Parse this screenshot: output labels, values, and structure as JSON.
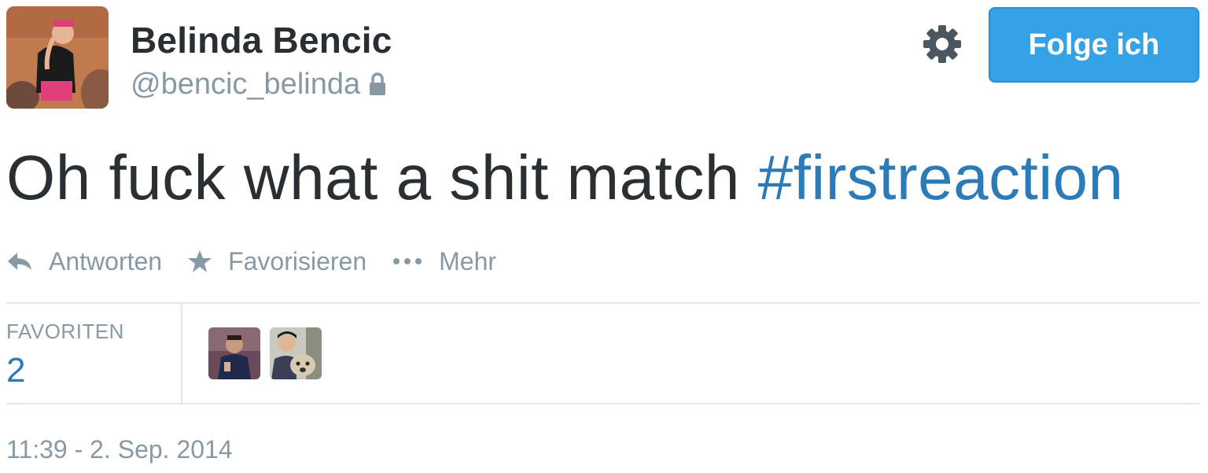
{
  "user": {
    "display_name": "Belinda Bencic",
    "handle": "@bencic_belinda",
    "protected_icon": "lock-icon"
  },
  "header": {
    "settings_icon": "gear-icon",
    "follow_label": "Folge ich"
  },
  "tweet": {
    "text": "Oh fuck what a shit match ",
    "hashtag": "#firstreaction"
  },
  "actions": [
    {
      "label": "Antworten",
      "icon": "reply-icon"
    },
    {
      "label": "Favorisieren",
      "icon": "star-icon"
    },
    {
      "label": "Mehr",
      "icon": "more-dots-icon"
    }
  ],
  "stats": {
    "favorites_label": "FAVORITEN",
    "favorites_count": "2"
  },
  "timestamp": "11:39 - 2. Sep. 2014",
  "colors": {
    "accent": "#35a1e7",
    "link": "#2b7bb9",
    "muted": "#8899a6",
    "text": "#292f33",
    "divider": "#e1e8ed"
  }
}
